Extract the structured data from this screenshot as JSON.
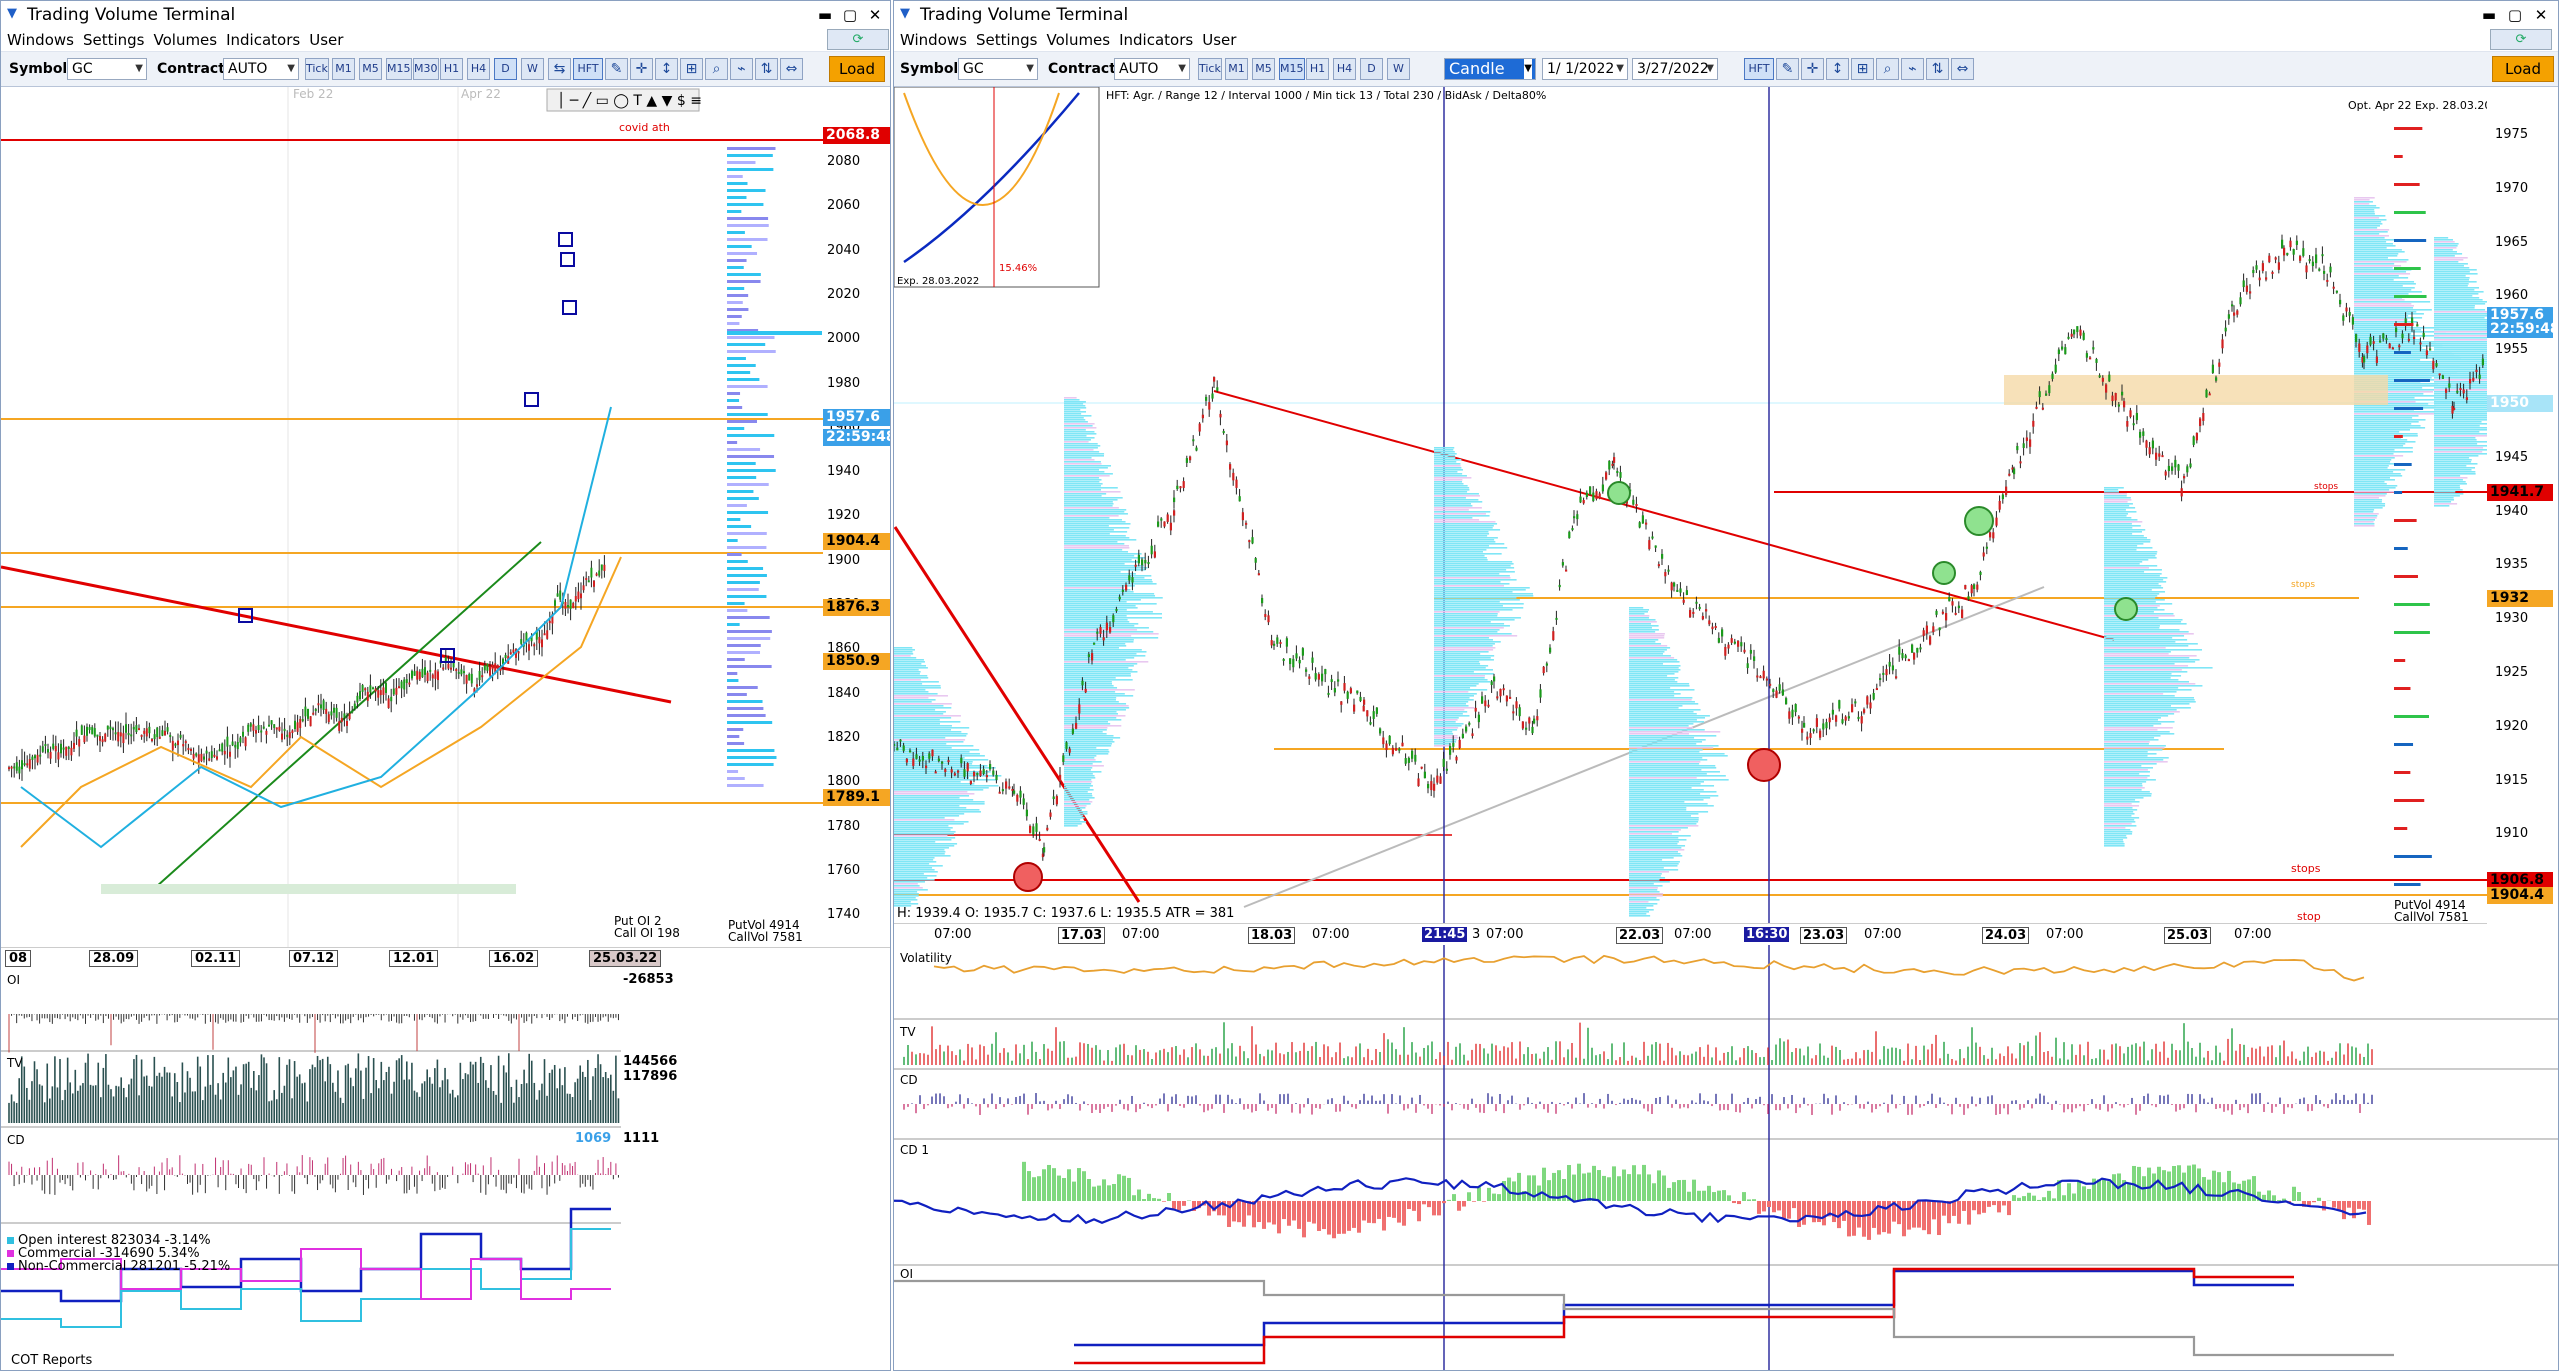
{
  "left": {
    "title": "Trading Volume Terminal",
    "menu": [
      "Windows",
      "Settings",
      "Volumes",
      "Indicators",
      "User"
    ],
    "symbol_label": "Symbol",
    "symbol_value": "GC",
    "contract_label": "Contract",
    "contract_value": "AUTO",
    "timeframes": [
      "Tick",
      "M1",
      "M5",
      "M15",
      "M30",
      "H1",
      "H4",
      "D",
      "W"
    ],
    "hft_label": "HFT",
    "load_label": "Load",
    "chart_header_labels": [
      "Feb 22",
      "Apr 22"
    ],
    "annotation": "covid ath",
    "price_scale": [
      "2080",
      "2060",
      "2040",
      "2020",
      "2000",
      "1980",
      "1960",
      "1940",
      "1920",
      "1900",
      "1880",
      "1860",
      "1840",
      "1820",
      "1800",
      "1780",
      "1760",
      "1740"
    ],
    "price_tags": [
      {
        "text": "2068.8",
        "bg": "#e00000",
        "fg": "#ffffff"
      },
      {
        "text": "1957.6",
        "bg": "#3aa0e8",
        "fg": "#ffffff"
      },
      {
        "text": "22:59:48",
        "bg": "#3aa0e8",
        "fg": "#ffffff"
      },
      {
        "text": "1904.4",
        "bg": "#f5a623",
        "fg": "#000000"
      },
      {
        "text": "1876.3",
        "bg": "#f5a623",
        "fg": "#000000"
      },
      {
        "text": "1850.9",
        "bg": "#f5a623",
        "fg": "#000000"
      },
      {
        "text": "1789.1",
        "bg": "#f5a623",
        "fg": "#000000"
      }
    ],
    "put_call": {
      "put_oi": "Put  OI  2",
      "call_oi": "Call  OI  198",
      "put_vol": "PutVol  4914",
      "call_vol": "CallVol  7581"
    },
    "date_axis": [
      "08",
      "28.09",
      "02.11",
      "07.12",
      "12.01",
      "16.02",
      "25.03.22"
    ],
    "oi_panel": {
      "label": "OI",
      "value": "-26853"
    },
    "tv_panel": {
      "label": "TV",
      "value1": "144566",
      "value2": "117896"
    },
    "cd_panel": {
      "label": "CD",
      "value1": "1069",
      "value2": "1111"
    },
    "cot_legend": [
      {
        "text": "Open interest   823034   -3.14%",
        "color": "#30c0e0"
      },
      {
        "text": "Commercial     -314690   5.34%",
        "color": "#e030e0"
      },
      {
        "text": "Non-Commercial   281201   -5.21%",
        "color": "#1020c0"
      }
    ],
    "cot_label": "COT Reports"
  },
  "right": {
    "title": "Trading Volume Terminal",
    "menu": [
      "Windows",
      "Settings",
      "Volumes",
      "Indicators",
      "User"
    ],
    "symbol_label": "Symbol",
    "symbol_value": "GC",
    "contract_label": "Contract",
    "contract_value": "AUTO",
    "timeframes": [
      "Tick",
      "M1",
      "M5",
      "M15",
      "H1",
      "H4",
      "D",
      "W"
    ],
    "chart_type": "Candle",
    "date_from": "1/ 1/2022",
    "date_to": "3/27/2022",
    "hft_label": "HFT",
    "load_label": "Load",
    "hft_info": "HFT: Agr. / Range 12 / Interval 1000 / Min tick 13 / Total 230 / BidAsk / Delta80%",
    "option_info": "Opt. Apr 22 Exp. 28.03.2022",
    "option_inset_pct": "15.46%",
    "option_inset_exp": "Exp. 28.03.2022",
    "ohlc": "H: 1939.4   O: 1935.7   C: 1937.6   L: 1935.5   ATR = 381",
    "price_scale": [
      "1975",
      "1970",
      "1965",
      "1960",
      "1955",
      "1950",
      "1945",
      "1940",
      "1935",
      "1930",
      "1925",
      "1920",
      "1915",
      "1910"
    ],
    "price_tags": [
      {
        "text": "1957.6",
        "bg": "#3aa0e8",
        "fg": "#ffffff"
      },
      {
        "text": "22:59:48",
        "bg": "#3aa0e8",
        "fg": "#ffffff"
      },
      {
        "text": "1950",
        "bg": "#a8e4f8",
        "fg": "#ffffff"
      },
      {
        "text": "1941.7",
        "bg": "#e00000",
        "fg": "#000000"
      },
      {
        "text": "1932",
        "bg": "#f5a623",
        "fg": "#000000"
      },
      {
        "text": "1906.8",
        "bg": "#e00000",
        "fg": "#000000"
      },
      {
        "text": "1904.4",
        "bg": "#f5a623",
        "fg": "#000000"
      }
    ],
    "side_labels": {
      "stops1": "stops",
      "stops2": "stops",
      "stop": "stop",
      "stops_small": "stops"
    },
    "put_call": {
      "put_vol": "PutVol  4914",
      "call_vol": "CallVol  7581"
    },
    "date_axis": [
      {
        "text": "07:00",
        "hl": false
      },
      {
        "text": "17.03",
        "hl": false
      },
      {
        "text": "07:00",
        "hl": false
      },
      {
        "text": "18.03",
        "hl": false
      },
      {
        "text": "07:00",
        "hl": false
      },
      {
        "text": "21:45",
        "hl": true
      },
      {
        "text": "3",
        "hl": false
      },
      {
        "text": "07:00",
        "hl": false
      },
      {
        "text": "22.03",
        "hl": false
      },
      {
        "text": "07:00",
        "hl": false
      },
      {
        "text": "16:30",
        "hl": true
      },
      {
        "text": "23.03",
        "hl": false
      },
      {
        "text": "07:00",
        "hl": false
      },
      {
        "text": "24.03",
        "hl": false
      },
      {
        "text": "07:00",
        "hl": false
      },
      {
        "text": "25.03",
        "hl": false
      },
      {
        "text": "07:00",
        "hl": false
      }
    ],
    "panels": {
      "volatility": "Volatility",
      "tv": "TV",
      "cd": "CD",
      "cd1": "CD 1",
      "oi": "OI"
    }
  }
}
